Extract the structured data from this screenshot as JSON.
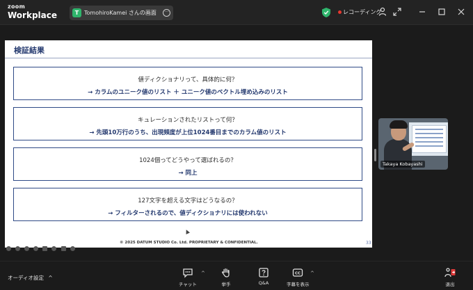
{
  "app": {
    "brand_top": "zoom",
    "brand_bottom": "Workplace"
  },
  "share_tab": {
    "avatar_letter": "T",
    "label": "TomohiroKamei さんの画面",
    "more": "···"
  },
  "recording": {
    "label": "レコーディング"
  },
  "slide": {
    "title": "検証結果",
    "items": [
      {
        "q": "値ディクショナリって、具体的に何？",
        "a": "→ カラムのユニーク値のリスト ＋ ユニーク値のベクトル埋め込みのリスト"
      },
      {
        "q": "キュレーションされたリストって何？",
        "a": "→ 先頭10万行のうち、出現頻度が上位1024番目までのカラム値のリスト"
      },
      {
        "q": "1024個ってどうやって選ばれるの？",
        "a": "→ 同上"
      },
      {
        "q": "127文字を超える文字はどうなるの？",
        "a": "→ フィルターされるので、値ディクショナリには使われない"
      }
    ],
    "footer": "© 2025 DATUM STUDIO Co. Ltd. PROPRIETARY & CONFIDENTIAL.",
    "page": "33"
  },
  "participant": {
    "name": "Takaya Kobayashi"
  },
  "toolbar": {
    "audio_label": "オーディオ設定",
    "audio_caret": "^",
    "chat": "チャット",
    "chat_caret": "^",
    "reactions": "挙手",
    "qa": "Q&A",
    "captions": "字幕を表示",
    "captions_caret": "^",
    "leave": "退出"
  },
  "colors": {
    "accent": "#23386e",
    "box_border": "#2f4a86",
    "rec": "#e6372f",
    "secure": "#2fb56c",
    "leave": "#e03a3a"
  }
}
